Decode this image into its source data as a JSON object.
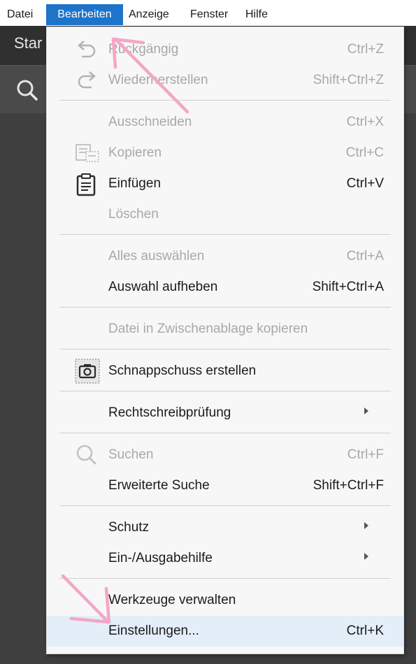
{
  "menubar": {
    "items": [
      "Datei",
      "Bearbeiten",
      "Anzeige",
      "Fenster",
      "Hilfe"
    ]
  },
  "app": {
    "tab_partial": "Star"
  },
  "menu": {
    "undo": {
      "label": "Rückgängig",
      "shortcut": "Ctrl+Z"
    },
    "redo": {
      "label": "Wiederherstellen",
      "shortcut": "Shift+Ctrl+Z"
    },
    "cut": {
      "label": "Ausschneiden",
      "shortcut": "Ctrl+X"
    },
    "copy": {
      "label": "Kopieren",
      "shortcut": "Ctrl+C"
    },
    "paste": {
      "label": "Einfügen",
      "shortcut": "Ctrl+V"
    },
    "delete": {
      "label": "Löschen"
    },
    "select_all": {
      "label": "Alles auswählen",
      "shortcut": "Ctrl+A"
    },
    "deselect": {
      "label": "Auswahl aufheben",
      "shortcut": "Shift+Ctrl+A"
    },
    "copy_file": {
      "label": "Datei in Zwischenablage kopieren"
    },
    "snapshot": {
      "label": "Schnappschuss erstellen"
    },
    "spellcheck": {
      "label": "Rechtschreibprüfung"
    },
    "search": {
      "label": "Suchen",
      "shortcut": "Ctrl+F"
    },
    "advanced_search": {
      "label": "Erweiterte Suche",
      "shortcut": "Shift+Ctrl+F"
    },
    "protection": {
      "label": "Schutz"
    },
    "accessibility": {
      "label": "Ein-/Ausgabehilfe"
    },
    "tools": {
      "label": "Werkzeuge verwalten"
    },
    "preferences": {
      "label": "Einstellungen...",
      "shortcut": "Ctrl+K"
    }
  },
  "colors": {
    "menu_active": "#1e74c9",
    "highlight": "#e3eef8",
    "annotation_arrow": "#f4a6c6"
  },
  "icons": [
    "undo-icon",
    "redo-icon",
    "copy-icon",
    "clipboard-icon",
    "camera-icon",
    "search-icon",
    "submenu-arrow-icon"
  ]
}
